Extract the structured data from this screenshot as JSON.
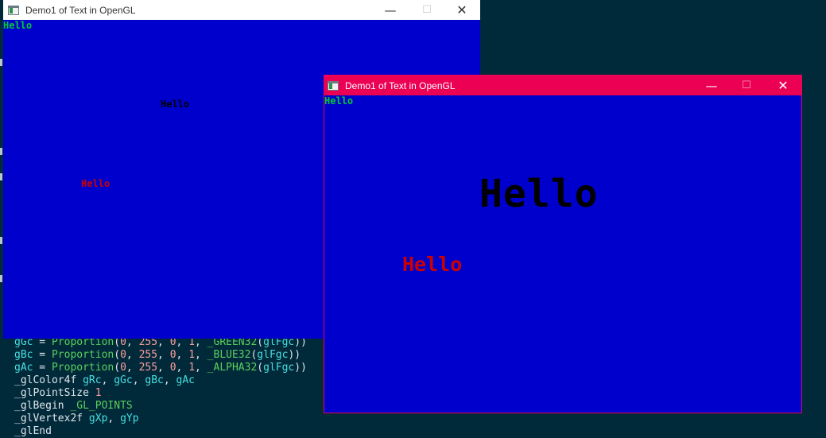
{
  "background_code": {
    "lines": [
      [
        [
          "gGc",
          "var"
        ],
        [
          " = ",
          "txt"
        ],
        [
          "Proportion",
          "fn"
        ],
        [
          "(",
          "txt"
        ],
        [
          "0",
          "num"
        ],
        [
          ", ",
          "txt"
        ],
        [
          "255",
          "num"
        ],
        [
          ", ",
          "txt"
        ],
        [
          "0",
          "num"
        ],
        [
          ", ",
          "txt"
        ],
        [
          "1",
          "num"
        ],
        [
          ", ",
          "txt"
        ],
        [
          "_GREEN32",
          "fn"
        ],
        [
          "(",
          "txt"
        ],
        [
          "glFgc",
          "var"
        ],
        [
          "))",
          "txt"
        ]
      ],
      [
        [
          "gBc",
          "var"
        ],
        [
          " = ",
          "txt"
        ],
        [
          "Proportion",
          "fn"
        ],
        [
          "(",
          "txt"
        ],
        [
          "0",
          "num"
        ],
        [
          ", ",
          "txt"
        ],
        [
          "255",
          "num"
        ],
        [
          ", ",
          "txt"
        ],
        [
          "0",
          "num"
        ],
        [
          ", ",
          "txt"
        ],
        [
          "1",
          "num"
        ],
        [
          ", ",
          "txt"
        ],
        [
          "_BLUE32",
          "fn"
        ],
        [
          "(",
          "txt"
        ],
        [
          "glFgc",
          "var"
        ],
        [
          "))",
          "txt"
        ]
      ],
      [
        [
          "gAc",
          "var"
        ],
        [
          " = ",
          "txt"
        ],
        [
          "Proportion",
          "fn"
        ],
        [
          "(",
          "txt"
        ],
        [
          "0",
          "num"
        ],
        [
          ", ",
          "txt"
        ],
        [
          "255",
          "num"
        ],
        [
          ", ",
          "txt"
        ],
        [
          "0",
          "num"
        ],
        [
          ", ",
          "txt"
        ],
        [
          "1",
          "num"
        ],
        [
          ", ",
          "txt"
        ],
        [
          "_ALPHA32",
          "fn"
        ],
        [
          "(",
          "txt"
        ],
        [
          "glFgc",
          "var"
        ],
        [
          "))",
          "txt"
        ]
      ],
      [
        [
          "_glColor4f ",
          "txt"
        ],
        [
          "gRc",
          "var"
        ],
        [
          ", ",
          "txt"
        ],
        [
          "gGc",
          "var"
        ],
        [
          ", ",
          "txt"
        ],
        [
          "gBc",
          "var"
        ],
        [
          ", ",
          "txt"
        ],
        [
          "gAc",
          "var"
        ]
      ],
      [
        [
          "_glPointSize ",
          "txt"
        ],
        [
          "1",
          "num"
        ]
      ],
      [
        [
          "_glBegin ",
          "txt"
        ],
        [
          "_GL_POINTS",
          "fn"
        ]
      ],
      [
        [
          "_glVertex2f ",
          "txt"
        ],
        [
          "gXp",
          "var"
        ],
        [
          ", ",
          "txt"
        ],
        [
          "gYp",
          "var"
        ]
      ],
      [
        [
          "_glEnd",
          "txt"
        ]
      ]
    ],
    "colors": {
      "var": "#47e0e0",
      "fn": "#5cd05c",
      "num": "#ff9d9d",
      "txt": "#dfe6ea"
    }
  },
  "window1": {
    "title": "Demo1 of Text in OpenGL",
    "controls": {
      "minimize": "—",
      "maximize": "☐",
      "close": "✕"
    },
    "texts": [
      {
        "text": "Hello",
        "color": "#00cc33"
      },
      {
        "text": "Hello",
        "color": "#000000"
      },
      {
        "text": "Hello",
        "color": "#cc0000"
      }
    ]
  },
  "window2": {
    "title": "Demo1 of Text in OpenGL",
    "controls": {
      "minimize": "—",
      "maximize": "☐",
      "close": "✕"
    },
    "texts": [
      {
        "text": "Hello",
        "color": "#00cc33"
      },
      {
        "text": "Hello",
        "color": "#000000"
      },
      {
        "text": "Hello",
        "color": "#cc0000"
      }
    ]
  },
  "colors": {
    "desktop": "#00293a",
    "client_blue": "#0000cc",
    "active_titlebar": "#eb0054"
  }
}
